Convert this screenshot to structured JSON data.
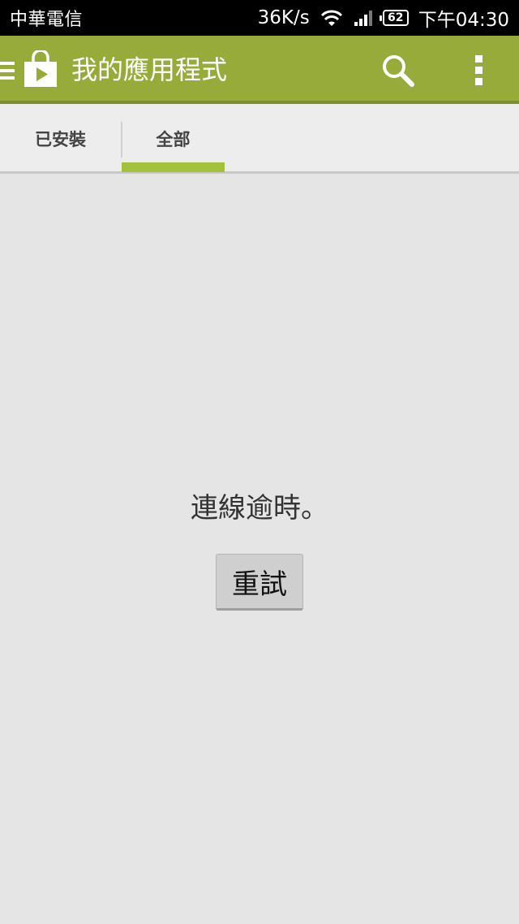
{
  "status_bar": {
    "carrier": "中華電信",
    "speed": "36K/s",
    "battery": "62",
    "time": "下午04:30",
    "icons": [
      "wifi-icon",
      "signal-icon",
      "battery-icon"
    ]
  },
  "app_bar": {
    "title": "我的應用程式",
    "icons": [
      "menu-icon",
      "play-store-bag-icon",
      "search-icon",
      "overflow-menu-icon"
    ],
    "background_color": "#97ab3b"
  },
  "tabs": [
    {
      "label": "已安裝",
      "selected": false
    },
    {
      "label": "全部",
      "selected": true
    }
  ],
  "accent_color": "#a4c13c",
  "content": {
    "message": "連線逾時。",
    "retry_label": "重試"
  }
}
